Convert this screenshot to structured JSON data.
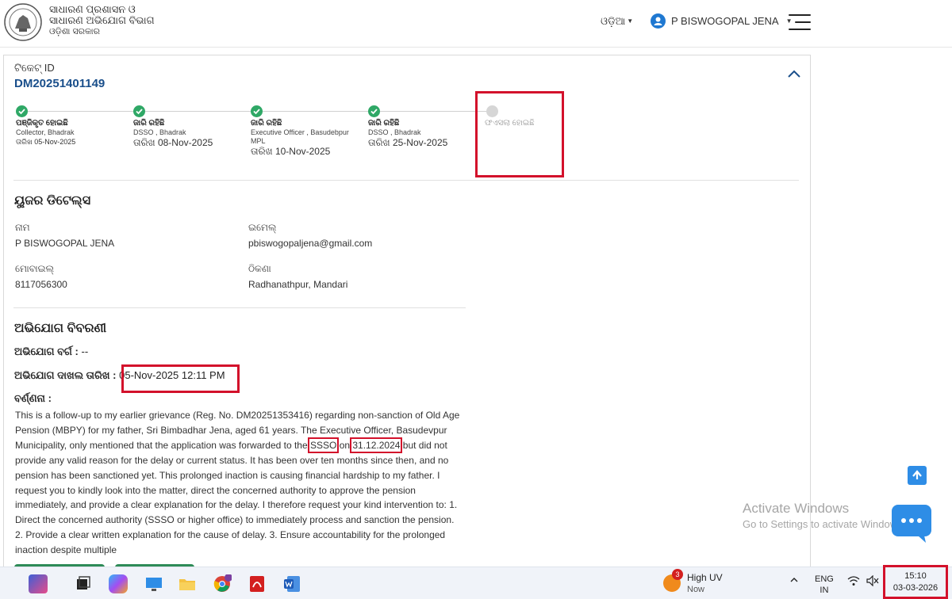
{
  "header": {
    "brand_line1": "ସାଧାରଣ ପ୍ରଶାସନ ଓ",
    "brand_line2": "ସାଧାରଣ ଅଭିଯୋଗ ବିଭାଗ",
    "brand_line3": "ଓଡ଼ିଶା ସରକାର",
    "language": "ଓଡ଼ିଆ",
    "user_name": "P BISWOGOPAL JENA"
  },
  "ticket": {
    "label": "ଟିକେଟ୍ ID",
    "id": "DM20251401149"
  },
  "timeline": [
    {
      "title": "ପଞ୍ଜିକୃତ ହୋଇଛି",
      "who": "Collector, Bhadrak",
      "who2": "",
      "date": "ତାରିଖ 05-Nov-2025",
      "status": "done"
    },
    {
      "title": "ଜାରି ରହିଛି",
      "who": "DSSO , Bhadrak",
      "who2": "",
      "date": "ତାରିଖ 08-Nov-2025",
      "status": "done"
    },
    {
      "title": "ଜାରି ରହିଛି",
      "who": "Executive Officer , Basudebpur",
      "who2": "MPL",
      "date": "ତାରିଖ 10-Nov-2025",
      "status": "done"
    },
    {
      "title": "ଜାରି ରହିଛି",
      "who": "DSSO , Bhadrak",
      "who2": "",
      "date": "ତାରିଖ 25-Nov-2025",
      "status": "done"
    },
    {
      "title": "ଫଏସଲା ହୋଇଛି",
      "who": "",
      "who2": "",
      "date": "",
      "status": "pending"
    }
  ],
  "user_details": {
    "title": "ୟୁଜର ଡିଟେଲ୍ସ",
    "name_label": "ନାମ",
    "name": "P BISWOGOPAL JENA",
    "email_label": "ଇମେଲ୍",
    "email": "pbiswogopaljena@gmail.com",
    "mobile_label": "ମୋବାଇଲ୍",
    "mobile": "8117056300",
    "address_label": "ଠିକଣା",
    "address": "Radhanathpur, Mandari"
  },
  "complaint": {
    "title": "ଅଭିଯୋଗ ବିବରଣୀ",
    "category_label": "ଅଭିଯୋଗ ବର୍ଗ :",
    "category": "--",
    "filed_label": "ଅଭିଯୋଗ ଦାଖଲ ତାରିଖ :",
    "filed_date": "05-Nov-2025 12:11 PM",
    "desc_label": "ବର୍ଣ୍ଣନା :",
    "desc_part1": "This is a follow-up to my earlier grievance (Reg. No. DM20251353416) regarding non-sanction of Old Age Pension (MBPY) for my father, Sri Bimbadhar Jena, aged 61 years. The Executive Officer, Basudevpur Municipality, only mentioned that the application was forwarded to the ",
    "desc_ssso": "SSSO",
    "desc_part2": " on ",
    "desc_date": "31.12.2024",
    "desc_part3": " but did not provide any valid reason for the delay or current status. It has been over ten months since then, and no pension has been sanctioned yet. This prolonged inaction is causing financial hardship to my father. I request you to kindly look into the matter, direct the concerned authority to approve the pension immediately, and provide a clear explanation for the delay. I therefore request your kind intervention to: 1. Direct the concerned authority (SSSO or higher office) to immediately process and sanction the pension. 2. Provide a clear written explanation for the cause of delay. 3. Ensure accountability for the prolonged inaction despite multiple"
  },
  "watermark": {
    "line1": "Activate Windows",
    "line2": "Go to Settings to activate Windows."
  },
  "taskbar": {
    "weather_badge": "3",
    "weather_title": "High UV",
    "weather_sub": "Now",
    "lang_line1": "ENG",
    "lang_line2": "IN",
    "time": "15:10",
    "date": "03-03-2026"
  },
  "colors": {
    "accent": "#1a4f8b",
    "success": "#2fa866",
    "highlight": "#d3112b",
    "chat": "#2e8de6"
  }
}
